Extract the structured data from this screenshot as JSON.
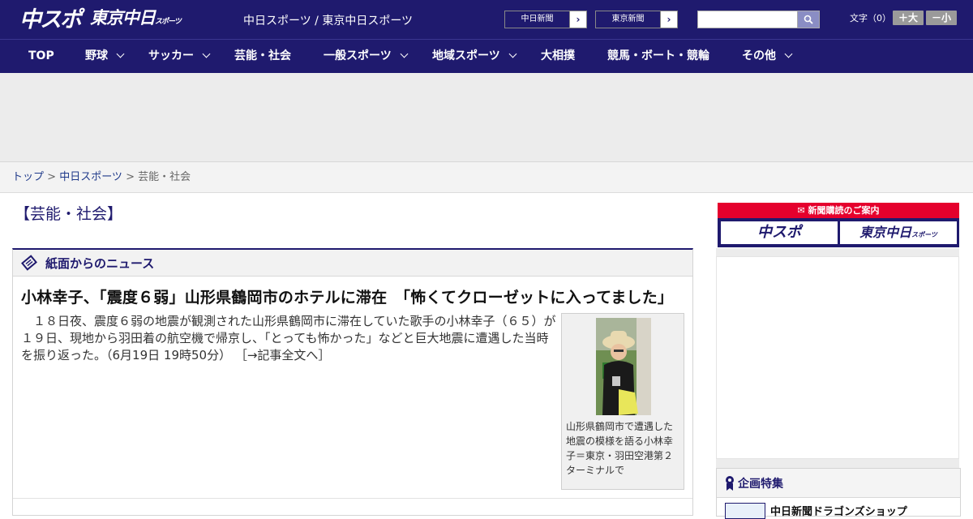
{
  "header": {
    "logo_chuspo": "中スポ",
    "logo_tokyo": "東京中日",
    "logo_tokyo_small": "スポーツ",
    "site_links": "中日スポーツ / 東京中日スポーツ",
    "btn_chunichi": "中日新聞",
    "btn_tokyo": "東京新聞",
    "search_placeholder": "",
    "font_label": "文字（0）",
    "font_larger": "＋大",
    "font_smaller": "－小"
  },
  "nav": [
    {
      "label": "TOP"
    },
    {
      "label": "野球"
    },
    {
      "label": "サッカー"
    },
    {
      "label": "芸能・社会"
    },
    {
      "label": "一般スポーツ"
    },
    {
      "label": "地域スポーツ"
    },
    {
      "label": "大相撲"
    },
    {
      "label": "競馬・ボート・競輪"
    },
    {
      "label": "その他"
    }
  ],
  "breadcrumb": {
    "top": "トップ",
    "sep1": " > ",
    "section": "中日スポーツ",
    "sep2": " > ",
    "current": "芸能・社会"
  },
  "page_title": "【芸能・社会】",
  "news": {
    "heading": "紙面からのニュース",
    "title": "小林幸子、「震度６弱」山形県鶴岡市のホテルに滞在　「怖くてクローゼットに入ってました」",
    "body": "　１８日夜、震度６弱の地震が観測された山形県鶴岡市に滞在していた歌手の小林幸子（６５）が１９日、現地から羽田着の航空機で帰京し、「とっても怖かった」などと巨大地震に遭遇した当時を振り返った。（6月19日 19時50分）",
    "more": "［→記事全文へ］",
    "photo_caption": "山形県鶴岡市で遭遇した地震の模様を語る小林幸子＝東京・羽田空港第２ターミナルで"
  },
  "sidebar": {
    "subscription_head": "新聞購読のご案内",
    "sub_btn_1": "中スポ",
    "sub_btn_2": "東京中日",
    "sub_btn_2_small": "スポーツ",
    "kikaku_head": "企画特集",
    "kikaku_item": "中日新聞ドラゴンズショップ"
  }
}
